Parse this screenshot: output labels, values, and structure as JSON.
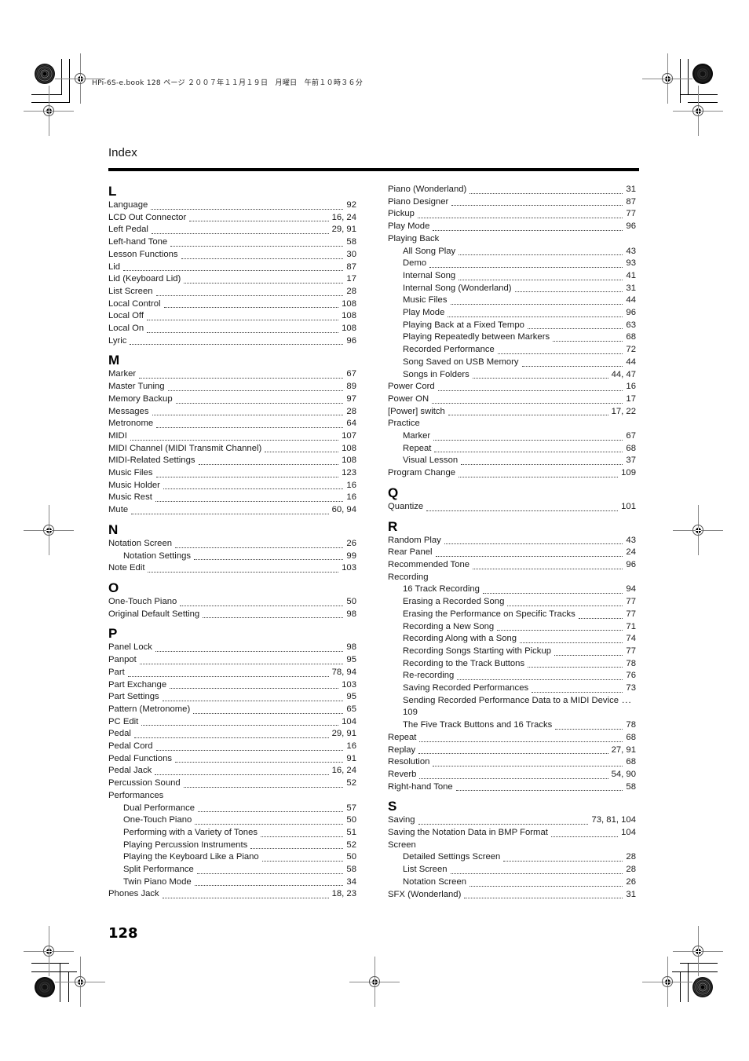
{
  "print_header": "HPi-6S-e.book 128 ページ ２００７年１１月１９日　月曜日　午前１０時３６分",
  "section_title": "Index",
  "page_number": "128",
  "left_column": [
    {
      "letter": "L",
      "entries": [
        {
          "label": "Language",
          "pages": "92"
        },
        {
          "label": "LCD Out Connector",
          "pages": "16, 24"
        },
        {
          "label": "Left Pedal",
          "pages": "29, 91"
        },
        {
          "label": "Left-hand Tone",
          "pages": "58"
        },
        {
          "label": "Lesson Functions",
          "pages": "30"
        },
        {
          "label": "Lid",
          "pages": "87"
        },
        {
          "label": "Lid (Keyboard Lid)",
          "pages": "17"
        },
        {
          "label": "List Screen",
          "pages": "28"
        },
        {
          "label": "Local Control",
          "pages": "108"
        },
        {
          "label": "Local Off",
          "pages": "108"
        },
        {
          "label": "Local On",
          "pages": "108"
        },
        {
          "label": "Lyric",
          "pages": "96"
        }
      ]
    },
    {
      "letter": "M",
      "entries": [
        {
          "label": "Marker",
          "pages": "67"
        },
        {
          "label": "Master Tuning",
          "pages": "89"
        },
        {
          "label": "Memory Backup",
          "pages": "97"
        },
        {
          "label": "Messages",
          "pages": "28"
        },
        {
          "label": "Metronome",
          "pages": "64"
        },
        {
          "label": "MIDI",
          "pages": "107"
        },
        {
          "label": "MIDI Channel (MIDI Transmit Channel)",
          "pages": "108"
        },
        {
          "label": "MIDI-Related Settings",
          "pages": "108"
        },
        {
          "label": "Music Files",
          "pages": "123"
        },
        {
          "label": "Music Holder",
          "pages": "16"
        },
        {
          "label": "Music Rest",
          "pages": "16"
        },
        {
          "label": "Mute",
          "pages": "60, 94"
        }
      ]
    },
    {
      "letter": "N",
      "entries": [
        {
          "label": "Notation Screen",
          "pages": "26"
        },
        {
          "label": "Notation Settings",
          "pages": "99",
          "sub": true
        },
        {
          "label": "Note Edit",
          "pages": "103"
        }
      ]
    },
    {
      "letter": "O",
      "entries": [
        {
          "label": "One-Touch Piano",
          "pages": "50"
        },
        {
          "label": "Original Default Setting",
          "pages": "98"
        }
      ]
    },
    {
      "letter": "P",
      "entries": [
        {
          "label": "Panel Lock",
          "pages": "98"
        },
        {
          "label": "Panpot",
          "pages": "95"
        },
        {
          "label": "Part",
          "pages": "78, 94"
        },
        {
          "label": "Part Exchange",
          "pages": "103"
        },
        {
          "label": "Part Settings",
          "pages": "95"
        },
        {
          "label": "Pattern (Metronome)",
          "pages": "65"
        },
        {
          "label": "PC Edit",
          "pages": "104"
        },
        {
          "label": "Pedal",
          "pages": "29, 91"
        },
        {
          "label": "Pedal Cord",
          "pages": "16"
        },
        {
          "label": "Pedal Functions",
          "pages": "91"
        },
        {
          "label": "Pedal Jack",
          "pages": "16, 24"
        },
        {
          "label": "Percussion Sound",
          "pages": "52"
        },
        {
          "label": "Performances",
          "pages": ""
        },
        {
          "label": "Dual Performance",
          "pages": "57",
          "sub": true
        },
        {
          "label": "One-Touch Piano",
          "pages": "50",
          "sub": true
        },
        {
          "label": "Performing with a Variety of Tones",
          "pages": "51",
          "sub": true
        },
        {
          "label": "Playing Percussion Instruments",
          "pages": "52",
          "sub": true
        },
        {
          "label": "Playing the Keyboard Like a Piano",
          "pages": "50",
          "sub": true
        },
        {
          "label": "Split Performance",
          "pages": "58",
          "sub": true
        },
        {
          "label": "Twin Piano Mode",
          "pages": "34",
          "sub": true
        },
        {
          "label": "Phones Jack",
          "pages": "18, 23"
        }
      ]
    }
  ],
  "right_column": [
    {
      "letter": "",
      "entries": [
        {
          "label": "Piano (Wonderland)",
          "pages": "31"
        },
        {
          "label": "Piano Designer",
          "pages": "87"
        },
        {
          "label": "Pickup",
          "pages": "77"
        },
        {
          "label": "Play Mode",
          "pages": "96"
        },
        {
          "label": "Playing Back",
          "pages": ""
        },
        {
          "label": "All Song Play",
          "pages": "43",
          "sub": true
        },
        {
          "label": "Demo",
          "pages": "93",
          "sub": true
        },
        {
          "label": "Internal Song",
          "pages": "41",
          "sub": true
        },
        {
          "label": "Internal Song (Wonderland)",
          "pages": "31",
          "sub": true
        },
        {
          "label": "Music Files",
          "pages": "44",
          "sub": true
        },
        {
          "label": "Play Mode",
          "pages": "96",
          "sub": true
        },
        {
          "label": "Playing Back at a Fixed Tempo",
          "pages": "63",
          "sub": true
        },
        {
          "label": "Playing Repeatedly between Markers",
          "pages": "68",
          "sub": true
        },
        {
          "label": "Recorded Performance",
          "pages": "72",
          "sub": true
        },
        {
          "label": "Song Saved on USB Memory",
          "pages": "44",
          "sub": true
        },
        {
          "label": "Songs in Folders",
          "pages": "44, 47",
          "sub": true
        },
        {
          "label": "Power Cord",
          "pages": "16"
        },
        {
          "label": "Power ON",
          "pages": "17"
        },
        {
          "label": "[Power] switch",
          "pages": "17, 22"
        },
        {
          "label": "Practice",
          "pages": ""
        },
        {
          "label": "Marker",
          "pages": "67",
          "sub": true
        },
        {
          "label": "Repeat",
          "pages": "68",
          "sub": true
        },
        {
          "label": "Visual Lesson",
          "pages": "37",
          "sub": true
        },
        {
          "label": "Program Change",
          "pages": "109"
        }
      ]
    },
    {
      "letter": "Q",
      "entries": [
        {
          "label": "Quantize",
          "pages": "101"
        }
      ]
    },
    {
      "letter": "R",
      "entries": [
        {
          "label": "Random Play",
          "pages": "43"
        },
        {
          "label": "Rear Panel",
          "pages": "24"
        },
        {
          "label": "Recommended Tone",
          "pages": "96"
        },
        {
          "label": "Recording",
          "pages": ""
        },
        {
          "label": "16 Track Recording",
          "pages": "94",
          "sub": true
        },
        {
          "label": "Erasing a Recorded Song",
          "pages": "77",
          "sub": true
        },
        {
          "label": "Erasing the Performance on Specific Tracks",
          "pages": "77",
          "sub": true
        },
        {
          "label": "Recording a New Song",
          "pages": "71",
          "sub": true
        },
        {
          "label": "Recording Along with a Song",
          "pages": "74",
          "sub": true
        },
        {
          "label": "Recording Songs Starting with Pickup",
          "pages": "77",
          "sub": true
        },
        {
          "label": "Recording to the Track Buttons",
          "pages": "78",
          "sub": true
        },
        {
          "label": "Re-recording",
          "pages": "76",
          "sub": true
        },
        {
          "label": "Saving Recorded Performances",
          "pages": "73",
          "sub": true
        },
        {
          "label": "Sending Recorded Performance Data to a MIDI Device",
          "pages": "109",
          "sub": true,
          "wrap": true
        },
        {
          "label": "The Five Track Buttons and 16 Tracks",
          "pages": "78",
          "sub": true
        },
        {
          "label": "Repeat",
          "pages": "68"
        },
        {
          "label": "Replay",
          "pages": "27, 91"
        },
        {
          "label": "Resolution",
          "pages": "68"
        },
        {
          "label": "Reverb",
          "pages": "54, 90"
        },
        {
          "label": "Right-hand Tone",
          "pages": "58"
        }
      ]
    },
    {
      "letter": "S",
      "entries": [
        {
          "label": "Saving",
          "pages": "73, 81, 104"
        },
        {
          "label": "Saving the Notation Data in BMP Format",
          "pages": "104"
        },
        {
          "label": "Screen",
          "pages": ""
        },
        {
          "label": "Detailed Settings Screen",
          "pages": "28",
          "sub": true
        },
        {
          "label": "List Screen",
          "pages": "28",
          "sub": true
        },
        {
          "label": "Notation Screen",
          "pages": "26",
          "sub": true
        },
        {
          "label": "SFX (Wonderland)",
          "pages": "31"
        }
      ]
    }
  ]
}
